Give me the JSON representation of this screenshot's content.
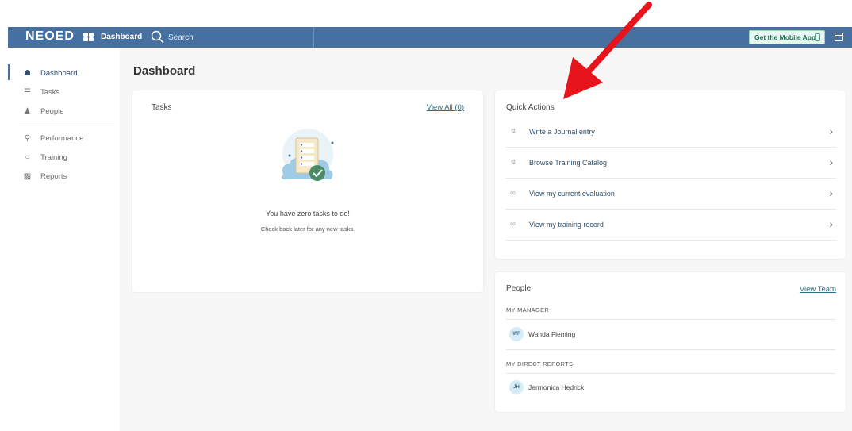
{
  "header": {
    "brand": "NEOED",
    "nav_label": "Dashboard",
    "search_label": "Search",
    "mobile_app_label": "Get the Mobile App"
  },
  "sidebar": {
    "items": [
      {
        "label": "Dashboard",
        "icon": "home-icon"
      },
      {
        "label": "Tasks",
        "icon": "list-icon"
      },
      {
        "label": "People",
        "icon": "people-icon"
      },
      {
        "label": "Performance",
        "icon": "trophy-icon"
      },
      {
        "label": "Training",
        "icon": "lightbulb-icon"
      },
      {
        "label": "Reports",
        "icon": "bar-chart-icon"
      }
    ]
  },
  "main": {
    "title": "Dashboard",
    "tasks": {
      "title": "Tasks",
      "view_all": "View All (0)",
      "empty_title": "You have zero tasks to do!",
      "empty_sub": "Check back later for any new tasks."
    },
    "quick_actions": {
      "title": "Quick Actions",
      "items": [
        {
          "label": "Write a Journal entry",
          "icon": "bolt-icon"
        },
        {
          "label": "Browse Training Catalog",
          "icon": "bolt-icon"
        },
        {
          "label": "View my current evaluation",
          "icon": "link-icon"
        },
        {
          "label": "View my training record",
          "icon": "link-icon"
        }
      ]
    },
    "people": {
      "title": "People",
      "view_team": "View Team",
      "manager_label": "MY MANAGER",
      "manager": {
        "initials": "WF",
        "name": "Wanda Fleming"
      },
      "reports_label": "MY DIRECT REPORTS",
      "reports": [
        {
          "initials": "JH",
          "name": "Jermonica Hedrick"
        }
      ]
    }
  },
  "colors": {
    "header_bg": "#45709f",
    "accent": "#2c6e8a",
    "annotation_arrow": "#e8141c"
  }
}
